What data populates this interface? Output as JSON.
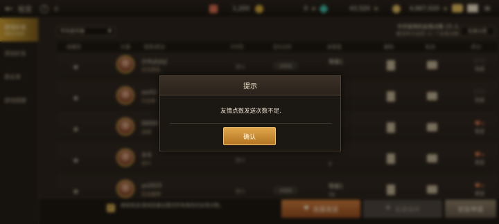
{
  "topbar": {
    "title": "社交",
    "back_icon": "back-arrow-icon",
    "help_label": "?",
    "resources": [
      {
        "name": "heart-currency",
        "value": "1,200",
        "color": "#d06a4a"
      },
      {
        "name": "coin-currency",
        "value": "0",
        "color": "#c9a235"
      },
      {
        "name": "gem-currency",
        "value": "43,520",
        "color": "#3fb8a0"
      },
      {
        "name": "gold-currency",
        "value": "4,667,020",
        "color": "#d4b05a"
      }
    ],
    "plus": "+"
  },
  "sidebar": {
    "items": [
      {
        "label": "游戏好友",
        "sub": "(80/100)",
        "active": true
      },
      {
        "label": "添加好友",
        "sub": "",
        "active": false
      },
      {
        "label": "黑名单",
        "sub": "",
        "active": false
      },
      {
        "label": "游戏相册",
        "sub": "",
        "active": false
      }
    ]
  },
  "main": {
    "filter": "所有服务器",
    "friend_info": {
      "today": "今天收到的友情点数 23 人",
      "yesterday": "截至昨天收到 21 个友情点数"
    },
    "bulk_settings": "批量设置",
    "headers": [
      "收藏夹",
      "头像",
      "昵称/职业",
      "서버명",
      "접속상태",
      "亲密度",
      "删除",
      "私信",
      "积分"
    ],
    "rows": [
      {
        "name": "오마냥냥냥",
        "job": "百花缭乱",
        "server": "한니",
        "status": "未登录",
        "level": "等级1",
        "intimacy": "",
        "gift_label": "完成",
        "gift_state": "done"
      },
      {
        "name": "sss52",
        "job": "天启者",
        "server": "",
        "status": "",
        "level": "",
        "intimacy": "",
        "gift_label": "完成",
        "gift_state": "done"
      },
      {
        "name": "DDDD",
        "job": "战魂",
        "server": "",
        "status": "",
        "level": "",
        "intimacy": "4",
        "gift_label": "发送",
        "gift_state": "send"
      },
      {
        "name": "초자",
        "job": "战斗",
        "server": "한니",
        "status": "",
        "level": "",
        "intimacy": "2",
        "gift_label": "发送",
        "gift_state": "send"
      },
      {
        "name": "ys2023",
        "job": "狂血魔神",
        "server": "한니",
        "status": "未登录",
        "level": "等级1",
        "intimacy": "70",
        "gift_label": "发送",
        "gift_state": "send"
      }
    ]
  },
  "bottom": {
    "checkbox_label": "继续发送/接收批量设置的所有角色的友情点数。",
    "send_all": "批量发送",
    "receive_all": "批量接收",
    "friend_request": "好友申请"
  },
  "modal": {
    "title": "提示",
    "message": "友情点数发送次数不足.",
    "confirm": "确认"
  }
}
